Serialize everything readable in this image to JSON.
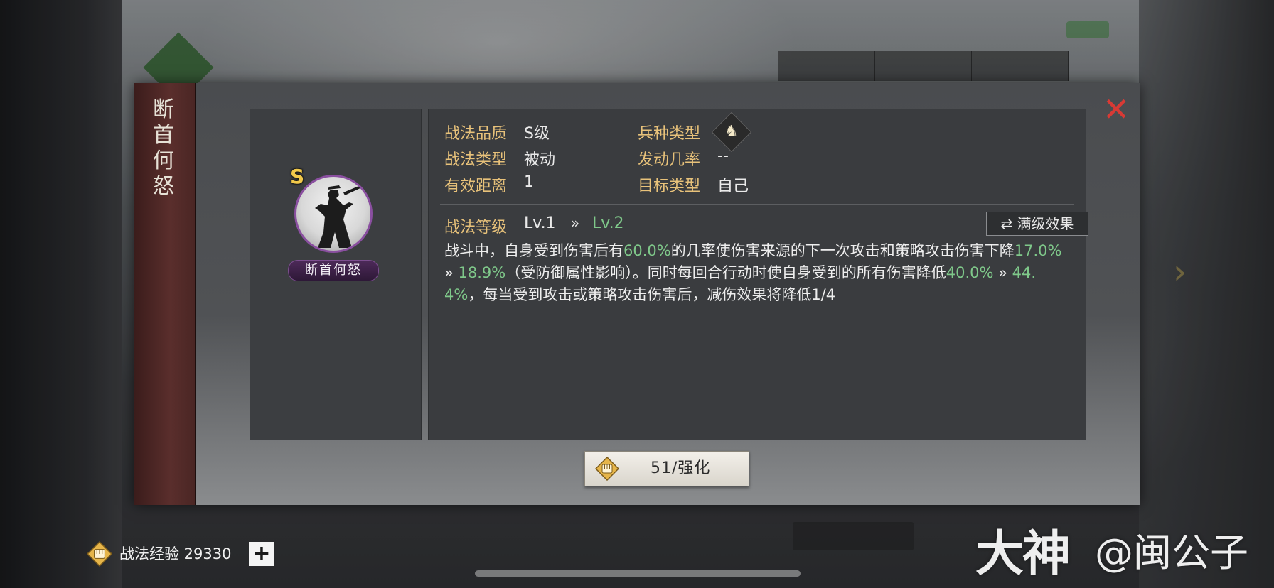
{
  "modal": {
    "side_title": "断首何怒",
    "close_icon": "close-x-icon",
    "skill": {
      "grade_badge": "S",
      "name_tag": "断首何怒"
    },
    "attributes": {
      "quality_label": "战法品质",
      "quality_value": "S级",
      "unit_type_label": "兵种类型",
      "unit_type_icon": "cavalry-horse-icon",
      "type_label": "战法类型",
      "type_value": "被动",
      "trigger_label": "发动几率",
      "trigger_value": "--",
      "range_label": "有效距离",
      "range_value": "1",
      "target_label": "目标类型",
      "target_value": "自己"
    },
    "level": {
      "label": "战法等级",
      "current": "Lv.1",
      "arrow": "»",
      "next": "Lv.2",
      "max_button_label": "⇄ 满级效果"
    },
    "description": {
      "p1": "战斗中，自身受到伤害后有",
      "v1": "60.0%",
      "p2": "的几率使伤害来源的下一次攻击和策略攻击伤害下降",
      "v2a": "17.0%",
      "arr2": " » ",
      "v2b": "18.9%",
      "p3": "（受防御属性影响）。同时每回合行动时使自身受到的所有伤害降低",
      "v3a": "40.0%",
      "arr3": " » ",
      "v3b": "44.4%",
      "p4": "，每当受到攻击或策略攻击伤害后，减伤效果将降低1/4"
    },
    "upgrade_button": {
      "icon": "fist-icon",
      "label": "51/强化"
    }
  },
  "footer": {
    "exp_icon": "fist-icon",
    "exp_text": "战法经验 29330",
    "plus_label": "+"
  },
  "watermark": {
    "brand": "大神",
    "handle": "@闽公子"
  },
  "colors": {
    "accent_gold": "#e8c27a",
    "highlight_green": "#7fc88a",
    "close_red": "#d83a35",
    "grade_purple": "#8a4fa0"
  }
}
